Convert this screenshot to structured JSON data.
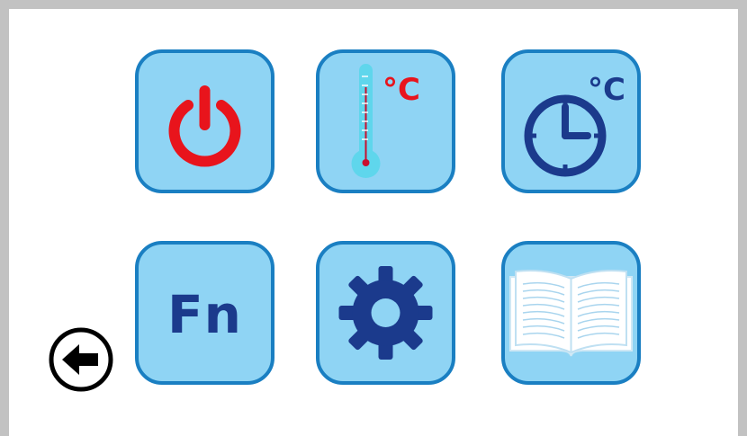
{
  "tiles": {
    "power": {
      "icon": "power-icon",
      "color": "#e8141c"
    },
    "temperature": {
      "icon": "thermometer-icon",
      "unit": "°C",
      "unit_color": "#e8141c"
    },
    "timer": {
      "icon": "clock-icon",
      "unit": "°C",
      "unit_color": "#1b3a8c"
    },
    "function": {
      "icon": "function-icon",
      "label": "Fn",
      "color": "#1b3a8c"
    },
    "settings": {
      "icon": "gear-icon",
      "color": "#1b3a8c"
    },
    "manual": {
      "icon": "book-icon"
    }
  },
  "navigation": {
    "back_icon": "back-arrow-icon"
  },
  "colors": {
    "tile_fill": "#8fd4f4",
    "tile_border": "#1a7fc2",
    "frame": "#c2c2c2"
  }
}
